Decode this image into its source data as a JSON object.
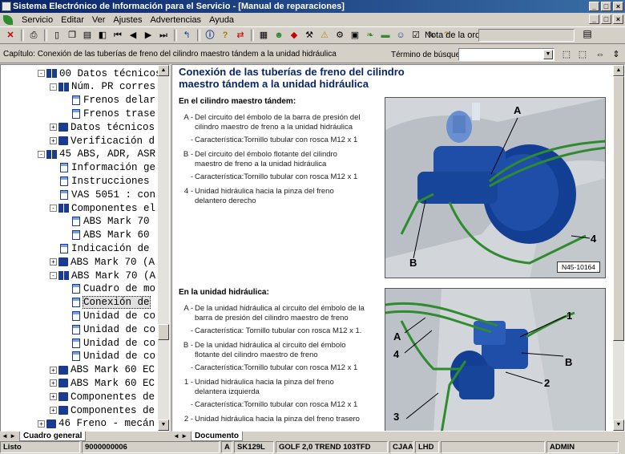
{
  "window": {
    "title": "Sistema Electrónico de Información para el Servicio - [Manual de reparaciones]"
  },
  "menu": [
    "Servicio",
    "Editar",
    "Ver",
    "Ajustes",
    "Advertencias",
    "Ayuda"
  ],
  "toolbar": {
    "order_label": "Nota de la orden:",
    "order_value": ""
  },
  "chapter": {
    "text": "Capítulo: Conexión de las tuberías de freno del cilindro maestro tándem a la unidad hidráulica",
    "search_label": "Término de búsqueda:",
    "search_value": ""
  },
  "tree": {
    "rows": [
      {
        "label": "00 Datos técnicos",
        "indent": 2,
        "icon": "book-open",
        "exp": "-"
      },
      {
        "label": "Núm. PR corres",
        "indent": 3,
        "icon": "book-open",
        "exp": "-"
      },
      {
        "label": "Frenos delar",
        "indent": 4,
        "icon": "doc",
        "exp": ""
      },
      {
        "label": "Frenos trase",
        "indent": 4,
        "icon": "doc",
        "exp": ""
      },
      {
        "label": "Datos técnicos",
        "indent": 3,
        "icon": "book",
        "exp": "+"
      },
      {
        "label": "Verificación d",
        "indent": 3,
        "icon": "book",
        "exp": "+"
      },
      {
        "label": "45 ABS, ADR, ASR",
        "indent": 2,
        "icon": "book-open",
        "exp": "-"
      },
      {
        "label": "Información ge",
        "indent": 3,
        "icon": "doc",
        "exp": ""
      },
      {
        "label": "Instrucciones",
        "indent": 3,
        "icon": "doc",
        "exp": ""
      },
      {
        "label": "VAS 5051 : con",
        "indent": 3,
        "icon": "doc",
        "exp": ""
      },
      {
        "label": "Componentes el",
        "indent": 3,
        "icon": "book-open",
        "exp": "-"
      },
      {
        "label": "ABS Mark 70",
        "indent": 4,
        "icon": "doc",
        "exp": ""
      },
      {
        "label": "ABS Mark 60",
        "indent": 4,
        "icon": "doc",
        "exp": ""
      },
      {
        "label": "Indicación de",
        "indent": 3,
        "icon": "doc",
        "exp": ""
      },
      {
        "label": "ABS Mark 70 (A",
        "indent": 3,
        "icon": "book",
        "exp": "+"
      },
      {
        "label": "ABS Mark 70 (A",
        "indent": 3,
        "icon": "book-open",
        "exp": "-"
      },
      {
        "label": "Cuadro de mo",
        "indent": 4,
        "icon": "doc",
        "exp": ""
      },
      {
        "label": "Conexión de",
        "indent": 4,
        "icon": "doc",
        "exp": "",
        "selected": true
      },
      {
        "label": "Unidad de co",
        "indent": 4,
        "icon": "doc",
        "exp": ""
      },
      {
        "label": "Unidad de co",
        "indent": 4,
        "icon": "doc",
        "exp": ""
      },
      {
        "label": "Unidad de co",
        "indent": 4,
        "icon": "doc",
        "exp": ""
      },
      {
        "label": "Unidad de co",
        "indent": 4,
        "icon": "doc",
        "exp": ""
      },
      {
        "label": "ABS Mark 60 EC",
        "indent": 3,
        "icon": "book",
        "exp": "+"
      },
      {
        "label": "ABS Mark 60 EC",
        "indent": 3,
        "icon": "book",
        "exp": "+"
      },
      {
        "label": "Componentes de",
        "indent": 3,
        "icon": "book",
        "exp": "+"
      },
      {
        "label": "Componentes de",
        "indent": 3,
        "icon": "book",
        "exp": "+"
      },
      {
        "label": "46 Freno - mecán",
        "indent": 2,
        "icon": "book",
        "exp": "+"
      }
    ],
    "tab_label": "Cuadro general"
  },
  "document": {
    "title": "Conexión de las tuberías de freno del cilindro maestro tándem a la unidad hidráulica",
    "tab_label": "Documento",
    "section1": {
      "heading": "En el cilindro maestro tándem:",
      "items": [
        {
          "key": "A -",
          "lines": [
            "Del circuito del émbolo de la barra de presión del",
            "cilindro maestro de freno a la unidad hidráulica"
          ]
        },
        {
          "key": "-",
          "lines": [
            "Característica:Tornillo tubular con rosca M12 x 1"
          ]
        },
        {
          "key": "B -",
          "lines": [
            "Del circuito del émbolo flotante del cilindro",
            "maestro de freno a la unidad hidráulica"
          ]
        },
        {
          "key": "-",
          "lines": [
            "Característica:Tornillo tubular con rosca M12 x 1"
          ]
        },
        {
          "key": "4 -",
          "lines": [
            "Unidad hidráulica hacia la pinza del freno",
            "delantero derecho"
          ]
        }
      ],
      "figure_id": "N45-10164",
      "callouts": [
        "A",
        "B",
        "4"
      ]
    },
    "section2": {
      "heading": "En la unidad hidráulica:",
      "items": [
        {
          "key": "A -",
          "lines": [
            "De la unidad hidráulica al circuito del émbolo de la",
            "barra de presión del cilindro maestro de freno"
          ]
        },
        {
          "key": "-",
          "lines": [
            "Característica: Tornillo tubular con rosca M12 x 1."
          ]
        },
        {
          "key": "B -",
          "lines": [
            "De la unidad hidráulica al circuito del émbolo",
            "flotante del cilindro maestro de freno"
          ]
        },
        {
          "key": "-",
          "lines": [
            "Característica:Tornillo tubular con rosca M12 x 1"
          ]
        },
        {
          "key": "1 -",
          "lines": [
            "Unidad hidráulica hacia la pinza del freno",
            "delantera izquierda"
          ]
        },
        {
          "key": "-",
          "lines": [
            "Característica:Tornillo tubular con rosca M12 x 1"
          ]
        },
        {
          "key": "2 -",
          "lines": [
            "Unidad hidráulica hacia la pinza del freno trasero"
          ]
        }
      ],
      "callouts": [
        "1",
        "A",
        "4",
        "B",
        "2",
        "3"
      ]
    }
  },
  "status": {
    "cells": [
      "Listo",
      "9000000006",
      "A",
      "SK129L",
      "GOLF 2,0 TREND 103TFD",
      "CJAA",
      "LHD",
      "",
      "ADMIN"
    ]
  },
  "colors": {
    "title_start": "#0a246a",
    "title_end": "#3a6ea5",
    "tree_book": "#1a3b8f",
    "doc_title": "#0a246a",
    "brake_line": "#2e8b2e",
    "component_blue": "#1e4ea8"
  }
}
